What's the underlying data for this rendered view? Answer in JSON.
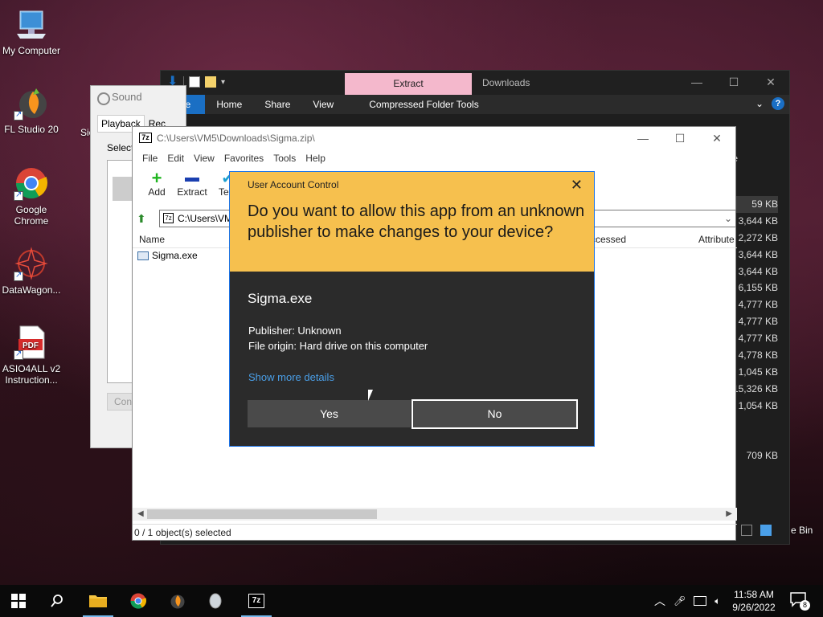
{
  "desktop": {
    "icons": [
      {
        "label": "My Computer"
      },
      {
        "label": "FL Studio 20"
      },
      {
        "label": "Google Chrome"
      },
      {
        "label": "DataWagon..."
      },
      {
        "label": "ASIO4ALL v2 Instruction..."
      }
    ],
    "pdf_icon_text": "PDF",
    "recycle_bin_partial": "e Bin"
  },
  "explorer": {
    "title": "Downloads",
    "contextual_tab": "Extract",
    "ribbon_tabs": [
      "File",
      "Home",
      "Share",
      "View",
      "Compressed Folder Tools"
    ],
    "sizes": [
      "59 KB",
      "3,644 KB",
      "2,272 KB",
      "3,644 KB",
      "3,644 KB",
      "6,155 KB",
      "4,777 KB",
      "4,777 KB",
      "4,777 KB",
      "4,778 KB",
      "1,045 KB",
      "15,326 KB",
      "1,054 KB",
      "",
      "",
      "709 KB"
    ],
    "column_partial": "e",
    "help_glyph": "?"
  },
  "sound": {
    "title": "Sound",
    "tab_playback": "Playback",
    "tab_recording": "Rec",
    "select_text": "Select",
    "configure_partial": "Con",
    "side_label_partial": "Sic"
  },
  "zip": {
    "title_path": "C:\\Users\\VM5\\Downloads\\Sigma.zip\\",
    "logo": "7z",
    "menu": [
      "File",
      "Edit",
      "View",
      "Favorites",
      "Tools",
      "Help"
    ],
    "toolbar": [
      {
        "label": "Add",
        "icon": "plus-icon"
      },
      {
        "label": "Extract",
        "icon": "minus-icon"
      },
      {
        "label": "Test",
        "icon": "check-icon"
      }
    ],
    "address": "C:\\Users\\VM",
    "columns": {
      "name": "Name",
      "accessed": "ccessed",
      "attributes": "Attribute"
    },
    "files": [
      {
        "name": "Sigma.exe"
      }
    ],
    "status": "0 / 1 object(s) selected"
  },
  "uac": {
    "caption": "User Account Control",
    "question": "Do you want to allow this app from an unknown publisher to make changes to your device?",
    "app_name": "Sigma.exe",
    "publisher": "Publisher: Unknown",
    "origin": "File origin: Hard drive on this computer",
    "more_details": "Show more details",
    "yes": "Yes",
    "no": "No",
    "accent_color": "#f6c04e"
  },
  "taskbar": {
    "time": "11:58 AM",
    "date": "9/26/2022",
    "notification_count": "8",
    "apps": [
      "start-icon",
      "search-icon",
      "file-explorer-icon",
      "chrome-icon",
      "fl-studio-icon",
      "app-icon",
      "7zip-icon"
    ]
  }
}
